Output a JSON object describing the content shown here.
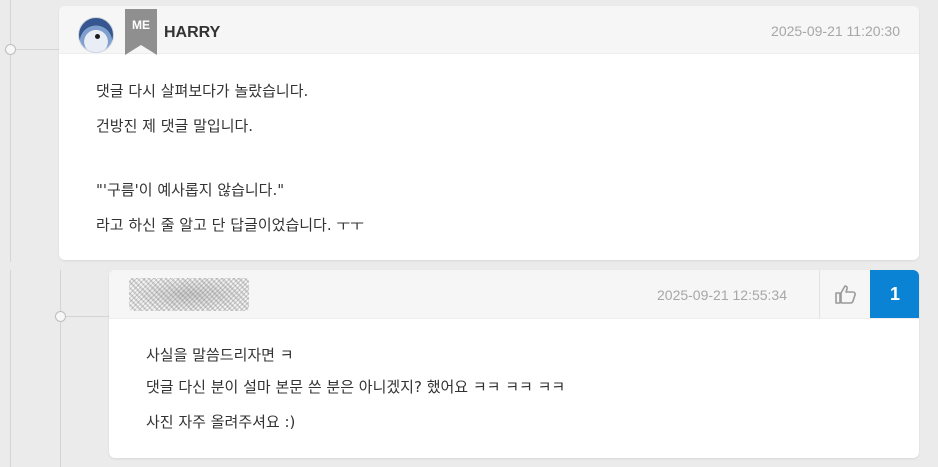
{
  "comment1": {
    "author": "HARRY",
    "badge": "ME",
    "timestamp": "2025-09-21 11:20:30",
    "lines": [
      "댓글 다시 살펴보다가 놀랐습니다.",
      "건방진 제 댓글 말입니다.",
      "",
      "\"'구름'이 예사롭지 않습니다.\"",
      "라고 하신 줄 알고 단 답글이었습니다. ㅜㅜ"
    ]
  },
  "comment2": {
    "timestamp": "2025-09-21 12:55:34",
    "like_count": "1",
    "lines": [
      "사실을 말씀드리자면 ㅋ",
      "댓글 다신 분이 설마 본문 쓴 분은 아니겠지? 했어요 ㅋㅋ ㅋㅋ ㅋㅋ",
      "사진 자주 올려주셔요 :)"
    ]
  },
  "icons": {
    "like": "thumbs-up-icon",
    "badge": "me-bookmark-badge",
    "avatar": "user-avatar"
  },
  "colors": {
    "accent": "#0b83d5",
    "badge_gray": "#8f8f8f"
  }
}
